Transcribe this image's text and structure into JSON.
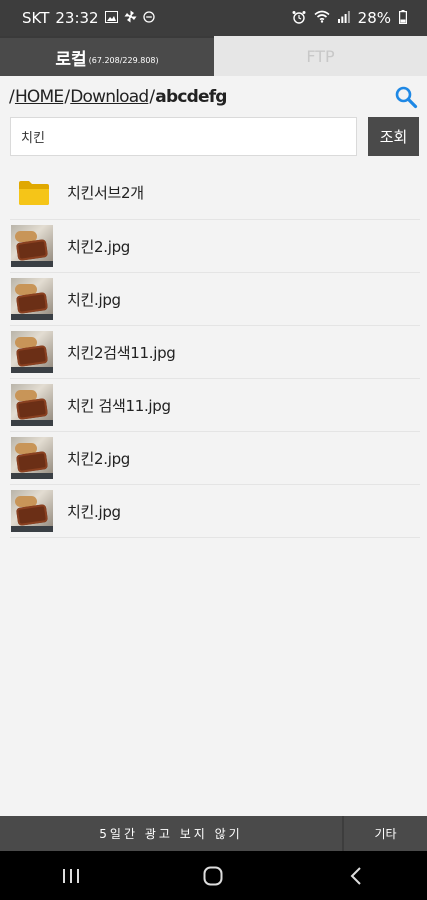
{
  "status_bar": {
    "carrier": "SKT",
    "time": "23:32",
    "battery": "28%",
    "icons": [
      "gallery-icon",
      "pinwheel-icon",
      "dnd-icon",
      "alarm-icon",
      "wifi-icon",
      "signal-icon"
    ]
  },
  "tabs": {
    "local_label": "로컬",
    "local_storage": "(67.208/229.808)",
    "ftp_label": "FTP"
  },
  "path": {
    "sep": "/",
    "home": "HOME",
    "download": "Download",
    "current": "abcdefg"
  },
  "search": {
    "value": "치킨",
    "button_label": "조회"
  },
  "files": [
    {
      "name": "치킨서브2개",
      "type": "folder"
    },
    {
      "name": "치킨2.jpg",
      "type": "image"
    },
    {
      "name": "치킨.jpg",
      "type": "image"
    },
    {
      "name": "치킨2검색11.jpg",
      "type": "image"
    },
    {
      "name": "치킨 검색11.jpg",
      "type": "image"
    },
    {
      "name": "치킨2.jpg",
      "type": "image"
    },
    {
      "name": "치킨.jpg",
      "type": "image"
    }
  ],
  "bottom_bar": {
    "hide_ads_label": "5일간 광고 보지 않기",
    "etc_label": "기타"
  },
  "colors": {
    "dark": "#3d3d3d",
    "search_accent": "#1e88e5",
    "folder": "#f5c518"
  }
}
